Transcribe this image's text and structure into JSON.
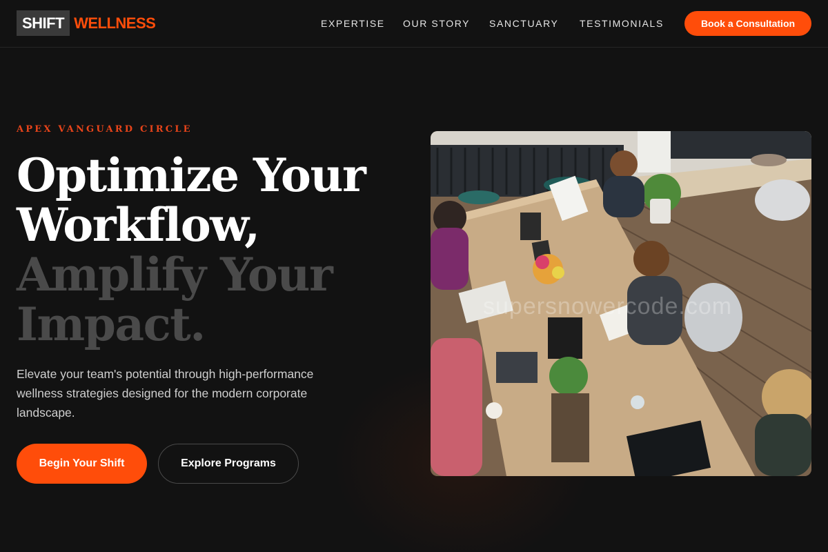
{
  "brand": {
    "logo_box": "SHIFT",
    "logo_accent": "WELLNESS"
  },
  "nav": {
    "items": [
      {
        "label": "EXPERTISE"
      },
      {
        "label": "OUR STORY"
      },
      {
        "label": "SANCTUARY"
      },
      {
        "label": "TESTIMONIALS"
      }
    ],
    "cta_label": "Book a Consultation"
  },
  "hero": {
    "eyebrow": "APEX VANGUARD CIRCLE",
    "headline_line1": "Optimize Your",
    "headline_line2": "Workflow,",
    "headline_line3": "Amplify Your",
    "headline_line4": "Impact.",
    "subtext": "Elevate your team's potential through high-performance wellness strategies designed for the modern corporate landscape.",
    "primary_button": "Begin Your Shift",
    "secondary_button": "Explore Programs"
  },
  "image": {
    "watermark": "supersnowercode.com"
  },
  "colors": {
    "accent": "#ff4d0a",
    "background": "#121212",
    "dim_text": "#4a4a4a"
  }
}
